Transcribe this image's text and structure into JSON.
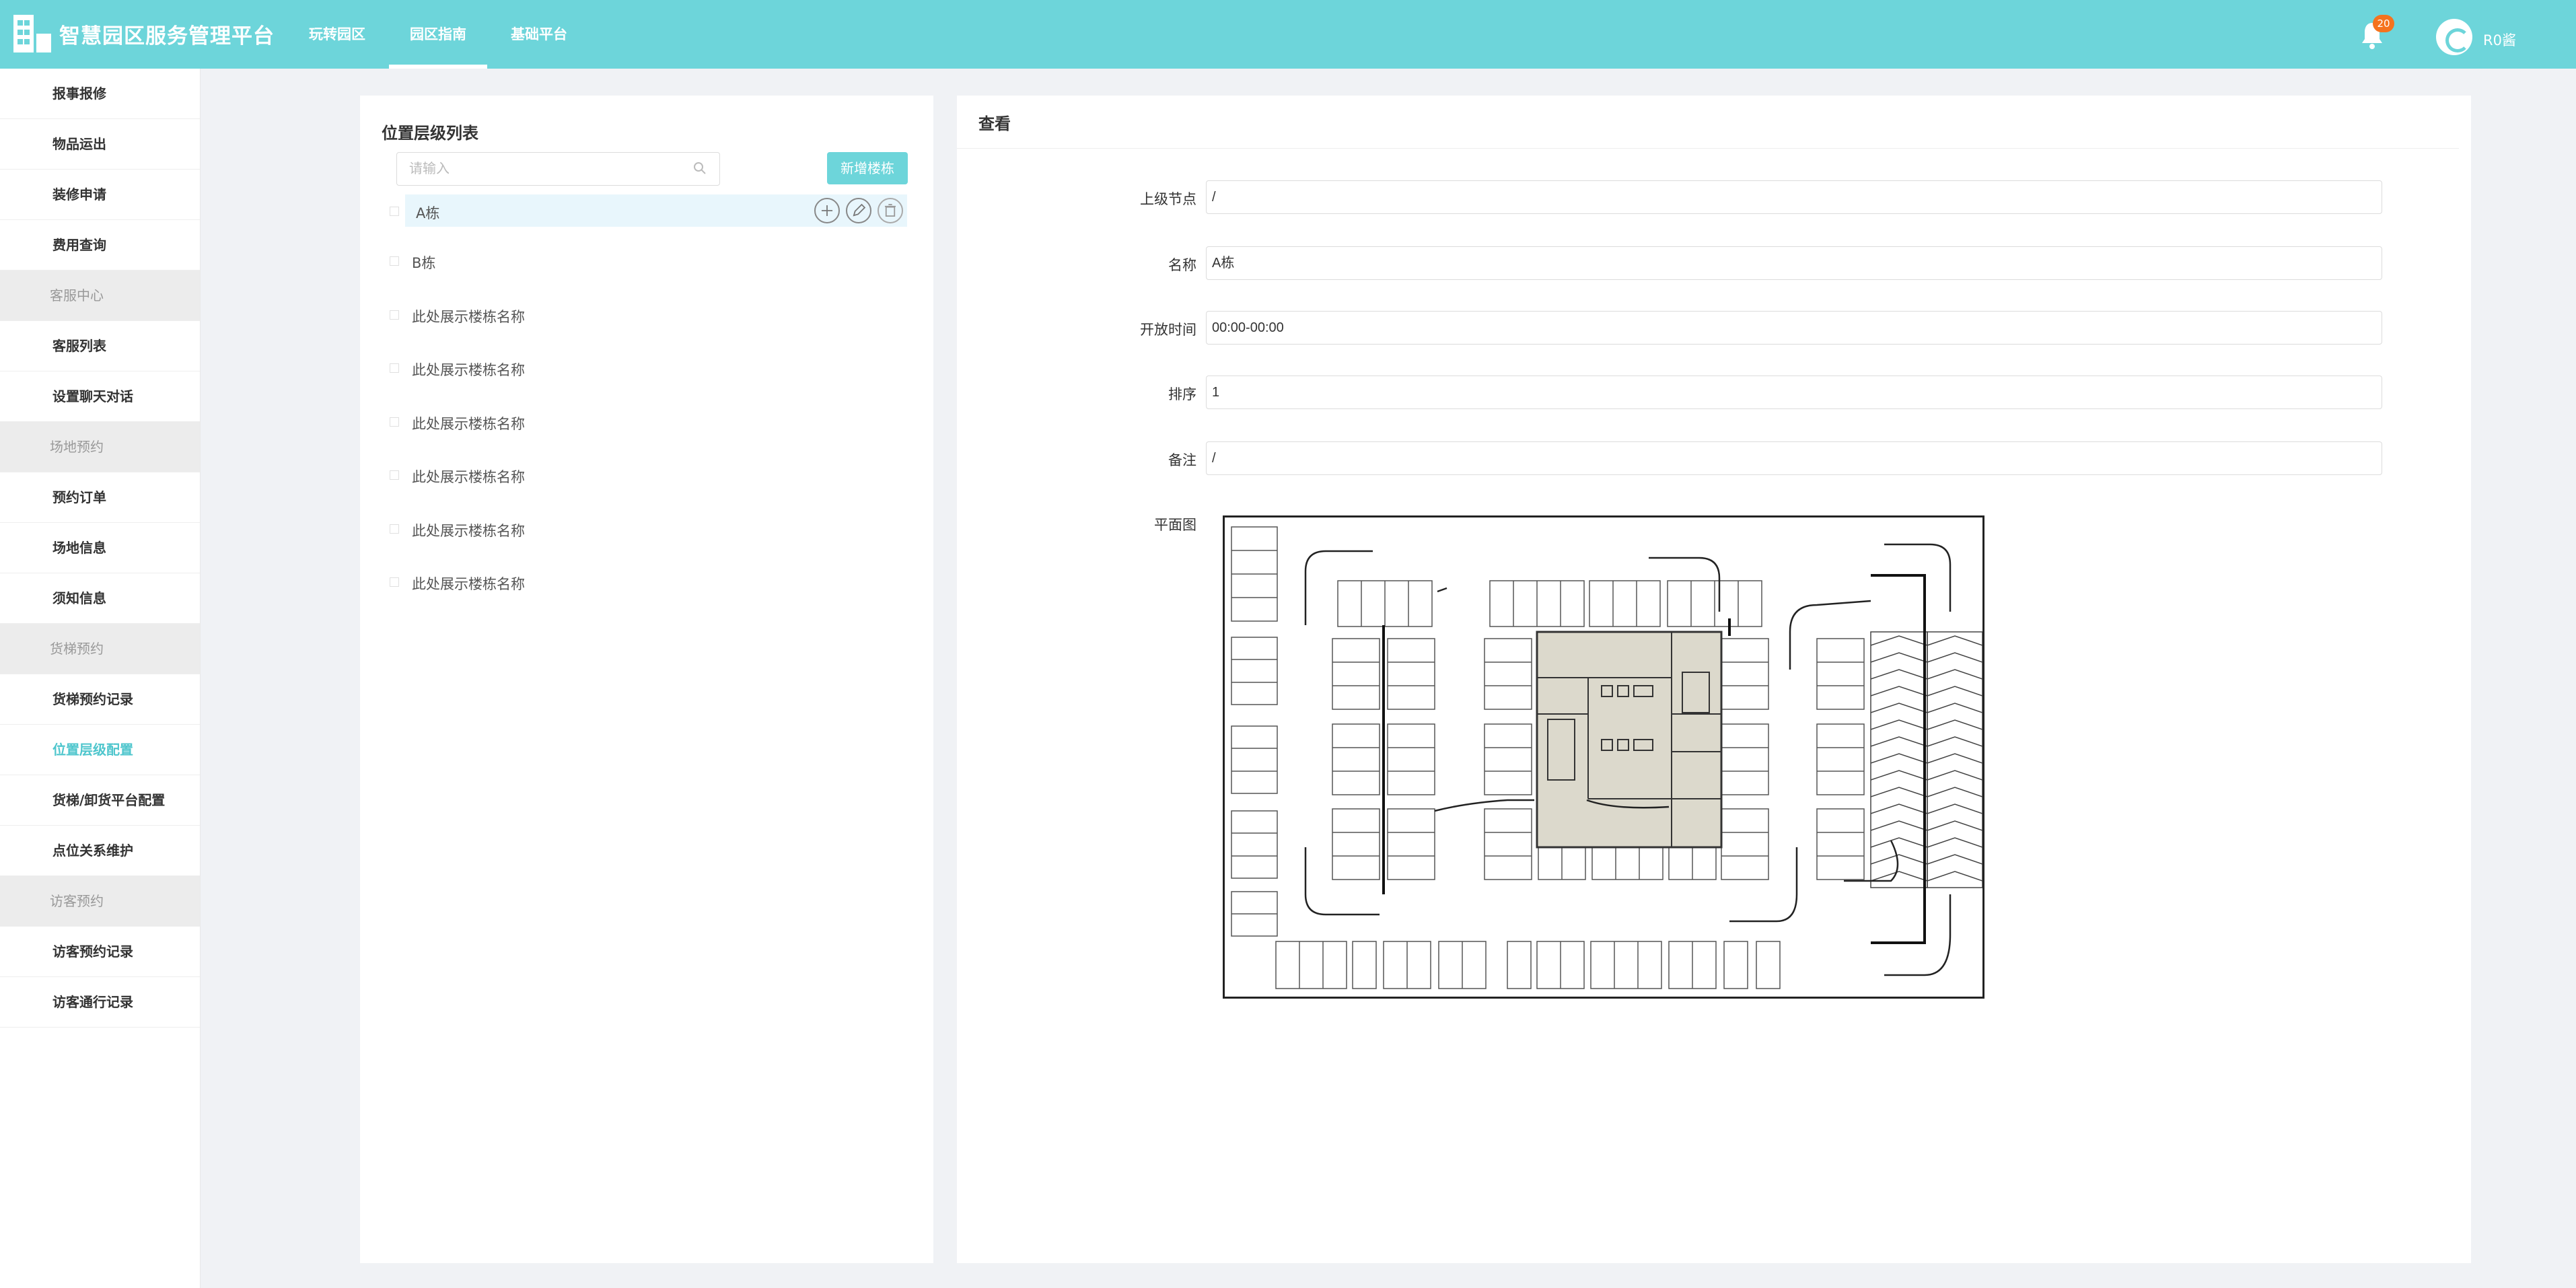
{
  "app": {
    "title": "智慧园区服务管理平台"
  },
  "nav": {
    "items": [
      {
        "label": "玩转园区"
      },
      {
        "label": "园区指南"
      },
      {
        "label": "基础平台"
      }
    ],
    "active_index": 1
  },
  "notifications": {
    "count": "20"
  },
  "user": {
    "name": "R0酱"
  },
  "sidebar": {
    "items": [
      {
        "label": "报事报修",
        "type": "item"
      },
      {
        "label": "物品运出",
        "type": "item"
      },
      {
        "label": "装修申请",
        "type": "item"
      },
      {
        "label": "费用查询",
        "type": "item"
      },
      {
        "label": "客服中心",
        "type": "group"
      },
      {
        "label": "客服列表",
        "type": "item"
      },
      {
        "label": "设置聊天对话",
        "type": "item"
      },
      {
        "label": "场地预约",
        "type": "group"
      },
      {
        "label": "预约订单",
        "type": "item"
      },
      {
        "label": "场地信息",
        "type": "item"
      },
      {
        "label": "须知信息",
        "type": "item"
      },
      {
        "label": "货梯预约",
        "type": "group"
      },
      {
        "label": "货梯预约记录",
        "type": "item"
      },
      {
        "label": "位置层级配置",
        "type": "item",
        "active": true
      },
      {
        "label": "货梯/卸货平台配置",
        "type": "item"
      },
      {
        "label": "点位关系维护",
        "type": "item"
      },
      {
        "label": "访客预约",
        "type": "group"
      },
      {
        "label": "访客预约记录",
        "type": "item"
      },
      {
        "label": "访客通行记录",
        "type": "item"
      }
    ]
  },
  "tree_panel": {
    "title": "位置层级列表",
    "search_placeholder": "请输入",
    "add_button": "新增楼栋",
    "nodes": [
      {
        "label": "A栋",
        "selected": true
      },
      {
        "label": "B栋"
      },
      {
        "label": "此处展示楼栋名称"
      },
      {
        "label": "此处展示楼栋名称"
      },
      {
        "label": "此处展示楼栋名称"
      },
      {
        "label": "此处展示楼栋名称"
      },
      {
        "label": "此处展示楼栋名称"
      },
      {
        "label": "此处展示楼栋名称"
      }
    ]
  },
  "detail": {
    "title": "查看",
    "fields": [
      {
        "label": "上级节点",
        "value": "/"
      },
      {
        "label": "名称",
        "value": "A栋"
      },
      {
        "label": "开放时间",
        "value": "00:00-00:00"
      },
      {
        "label": "排序",
        "value": "1"
      },
      {
        "label": "备注",
        "value": "/"
      }
    ],
    "plan_label": "平面图"
  },
  "colors": {
    "accent": "#6dd5da",
    "active_text": "#4fc6cd",
    "badge": "#f5731e",
    "selected_row": "#e8f6fc"
  }
}
